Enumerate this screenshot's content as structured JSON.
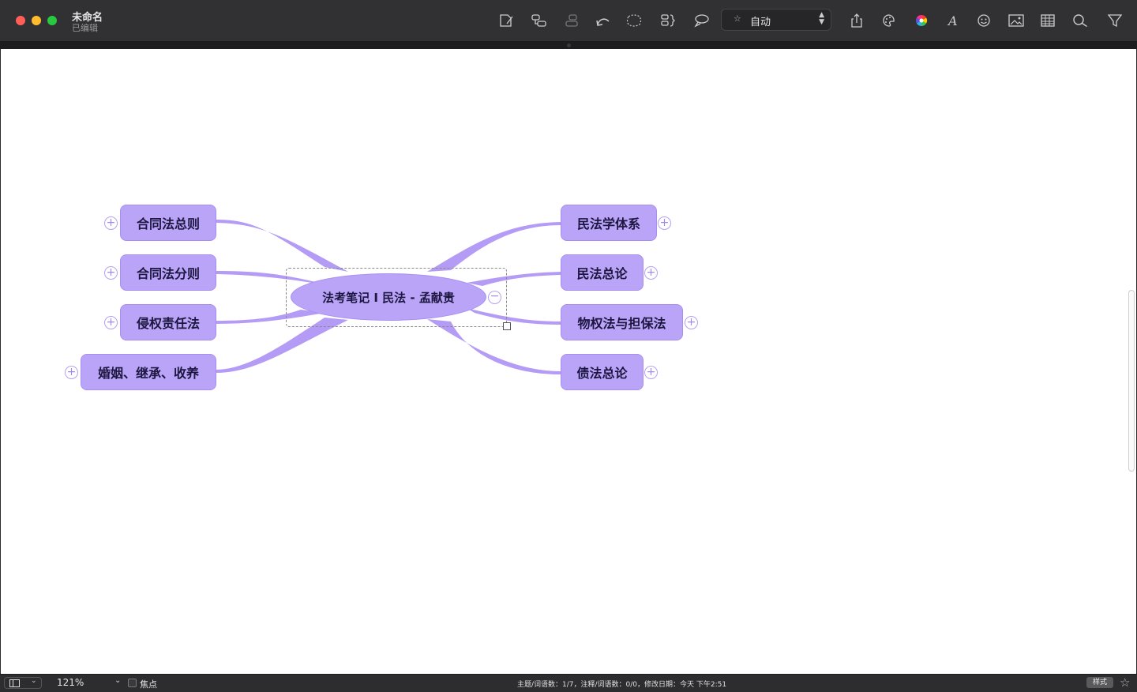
{
  "window": {
    "title": "未命名",
    "subtitle": "已编辑"
  },
  "toolbar": {
    "layout_value": "自动",
    "icons": [
      "new-document-icon",
      "subtopic-icon",
      "fold-icon",
      "undo-icon",
      "boundary-icon",
      "summary-icon",
      "callout-icon",
      "share-icon",
      "palette-icon",
      "color-wheel-icon",
      "font-icon",
      "emoji-icon",
      "image-icon",
      "table-icon",
      "search-icon",
      "filter-icon"
    ]
  },
  "mindmap": {
    "root": "法考笔记 I 民法 - 孟献贵",
    "left_topics": [
      "合同法总则",
      "合同法分则",
      "侵权责任法",
      "婚姻、继承、收养"
    ],
    "right_topics": [
      "民法学体系",
      "民法总论",
      "物权法与担保法",
      "债法总论"
    ]
  },
  "status": {
    "zoom": "121%",
    "focus_label": "焦点",
    "stats": "主题/词语数：1/7，注释/词语数：0/0，修改日期：今天 下午2:51",
    "style_label": "样式"
  },
  "colors": {
    "topic_fill": "#b9a4f7",
    "topic_border": "#a88ef2",
    "branch": "#b49cf6",
    "toolbar_bg": "#313133"
  }
}
